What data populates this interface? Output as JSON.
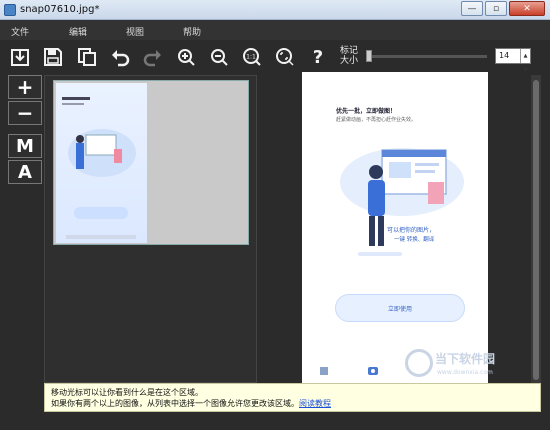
{
  "window": {
    "title": "snap07610.jpg*",
    "buttons": [
      "—",
      "▫",
      "✕"
    ]
  },
  "menu": [
    "文件",
    "编辑",
    "视图",
    "帮助"
  ],
  "toolbar": {
    "icons": [
      "import-icon",
      "save-icon",
      "copy-icon",
      "undo-icon",
      "redo-icon",
      "zoom-in-icon",
      "zoom-out-icon",
      "actual-size-icon",
      "fit-window-icon",
      "help-icon"
    ],
    "mark_size_label_line1": "标记",
    "mark_size_label_line2": "大小",
    "mark_size_value": "14",
    "mark_size_slider_level": 0.02
  },
  "left_tools": [
    "+",
    "−",
    "M",
    "A"
  ],
  "preview": {
    "headline": "优先一批，立即做图！",
    "subline": "赶紧做动画，不再担心赶作业失效。",
    "slogan_line1": "可以把你的图片，",
    "slogan_line2": "一键 转换、翻译",
    "button_label": "立即使用"
  },
  "info": {
    "line1": "移动光标可以让你看到什么是在这个区域。",
    "line2": "如果你有两个以上的图像，从列表中选择一个图像允许您更改该区域。",
    "link": "阅读教程"
  },
  "watermark": {
    "text": "当下软件园",
    "url": "www.downxia.com"
  },
  "colors": {
    "accent": "#3361c6",
    "tooltip_bg": "#ffffe1",
    "app_bg": "#2b2b2b"
  }
}
